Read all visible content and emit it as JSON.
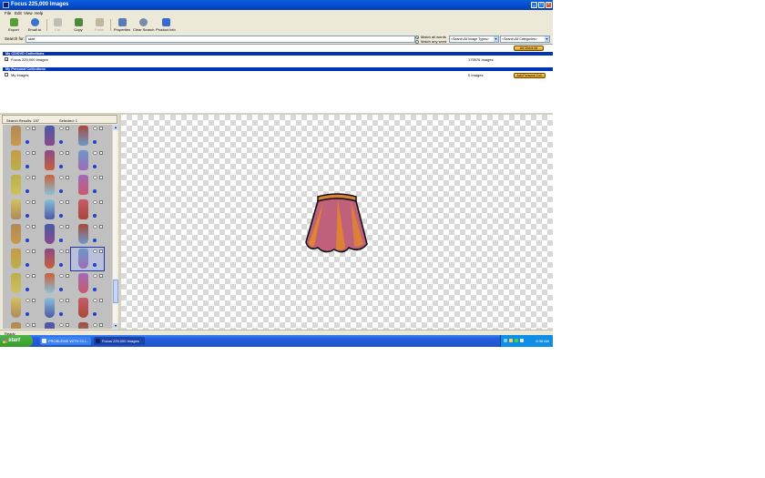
{
  "window": {
    "title": "Focus 225,000 Images"
  },
  "menu": [
    "File",
    "Edit",
    "View",
    "Help"
  ],
  "toolbar": {
    "buttons": [
      {
        "label": "Export",
        "icon": "export-icon"
      },
      {
        "label": "Email to",
        "icon": "email-icon"
      },
      {
        "label": "Cut",
        "icon": "cut-icon"
      },
      {
        "label": "Copy",
        "icon": "copy-icon"
      },
      {
        "label": "Paste",
        "icon": "paste-icon"
      },
      {
        "label": "Properties",
        "icon": "properties-icon"
      },
      {
        "label": "Clear Search",
        "icon": "clear-search-icon"
      },
      {
        "label": "Product Info",
        "icon": "product-info-icon"
      }
    ]
  },
  "search": {
    "label": "Search for:",
    "value": "skirt",
    "match_all": "Match all words",
    "match_any": "Match any word",
    "image_type": "<Search All Image Types>",
    "category": "<Search All Categories>"
  },
  "collections": {
    "cd_header": "My CD/DVD Collections",
    "cd_button": "Ad Check All",
    "cd_items": [
      {
        "name": "Focus 225,000 Images",
        "count": "175576 Images",
        "checked": true
      }
    ],
    "personal_header": "My Personal Collections",
    "personal_items": [
      {
        "name": "My Images",
        "count": "0 Images",
        "checked": false
      }
    ],
    "personal_button": "Add Personal Coll."
  },
  "results": {
    "label": "Search Results: 197",
    "selected": "Selected: 1"
  },
  "status": "Ready",
  "taskbar": {
    "start": "start",
    "tasks": [
      "PROBLEMS WITH CLI...",
      "Focus 225,000 Images"
    ],
    "clock": "8:38 AM"
  },
  "colors": {
    "title_bar": "#0349c8",
    "collection_header": "#0033b5",
    "taskbar": "#245edb",
    "start": "#379c2b",
    "skirt_main": "#c0607a",
    "skirt_accent": "#e0862e"
  }
}
